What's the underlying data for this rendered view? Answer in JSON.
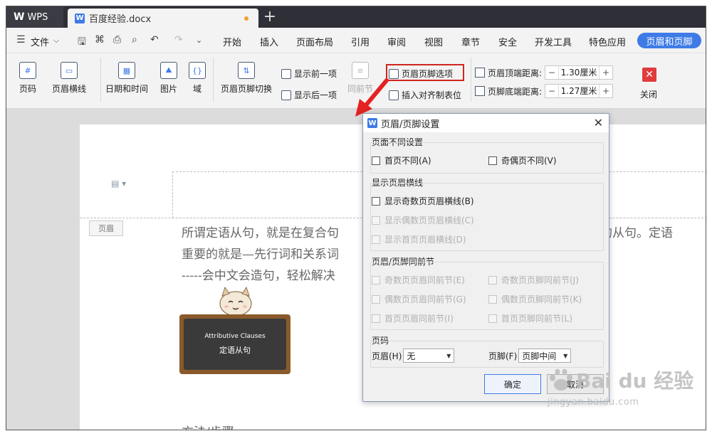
{
  "titlebar": {
    "app_name": "WPS",
    "doc_tab": "百度经验.docx",
    "add_tab_glyph": "+"
  },
  "menubar": {
    "file_label": "文件",
    "items": [
      "开始",
      "插入",
      "页面布局",
      "引用",
      "审阅",
      "视图",
      "章节",
      "安全",
      "开发工具",
      "特色应用"
    ],
    "active_tab": "页眉和页脚"
  },
  "ribbon": {
    "page_number": "页码",
    "header_line": "页眉横线",
    "date_time": "日期和时间",
    "picture": "图片",
    "field": "域",
    "switch": "页眉页脚切换",
    "show_prev": "显示前一项",
    "show_next": "显示后一项",
    "same_as_prev": "同前节",
    "hf_options": "页眉页脚选项",
    "insert_tab": "插入对齐制表位",
    "top_dist_label": "页眉顶端距离:",
    "top_dist_value": "1.30厘米",
    "bottom_dist_label": "页脚底端距离:",
    "bottom_dist_value": "1.27厘米",
    "minus": "−",
    "plus": "+",
    "close": "关闭"
  },
  "document": {
    "header_tag": "页眉",
    "line1": "所谓定语从句，就是在复合句",
    "line1_right": "词的从句。定语",
    "line2": "重要的就是—先行词和关系词",
    "line3": "-----会中文会造句，轻松解决",
    "board_en": "Attributive Clauses",
    "board_cn": "定语从句",
    "method": "方法/步骤"
  },
  "dialog": {
    "title": "页眉/页脚设置",
    "close_glyph": "✕",
    "section1": "页面不同设置",
    "first_page_diff": "首页不同(A)",
    "odd_even_diff": "奇偶页不同(V)",
    "section2": "显示页眉横线",
    "show_odd_line": "显示奇数页页眉横线(B)",
    "show_even_line": "显示偶数页页眉横线(C)",
    "show_first_line": "显示首页页眉横线(D)",
    "section3": "页眉/页脚同前节",
    "odd_header_same": "奇数页页眉同前节(E)",
    "odd_footer_same": "奇数页页脚同前节(J)",
    "even_header_same": "偶数页页眉同前节(G)",
    "even_footer_same": "偶数页页脚同前节(K)",
    "first_header_same": "首页页眉同前节(I)",
    "first_footer_same": "首页页脚同前节(L)",
    "section4": "页码",
    "header_label": "页眉(H)",
    "header_value": "无",
    "footer_label": "页脚(F)",
    "footer_value": "页脚中间",
    "ok": "确定",
    "cancel": "取消"
  },
  "watermark": {
    "text": "Bai du 经验",
    "url": "jingyan.baidu.com"
  },
  "colors": {
    "accent": "#3e7be6",
    "highlight": "#d0261f",
    "titlebar": "#2f3037"
  }
}
